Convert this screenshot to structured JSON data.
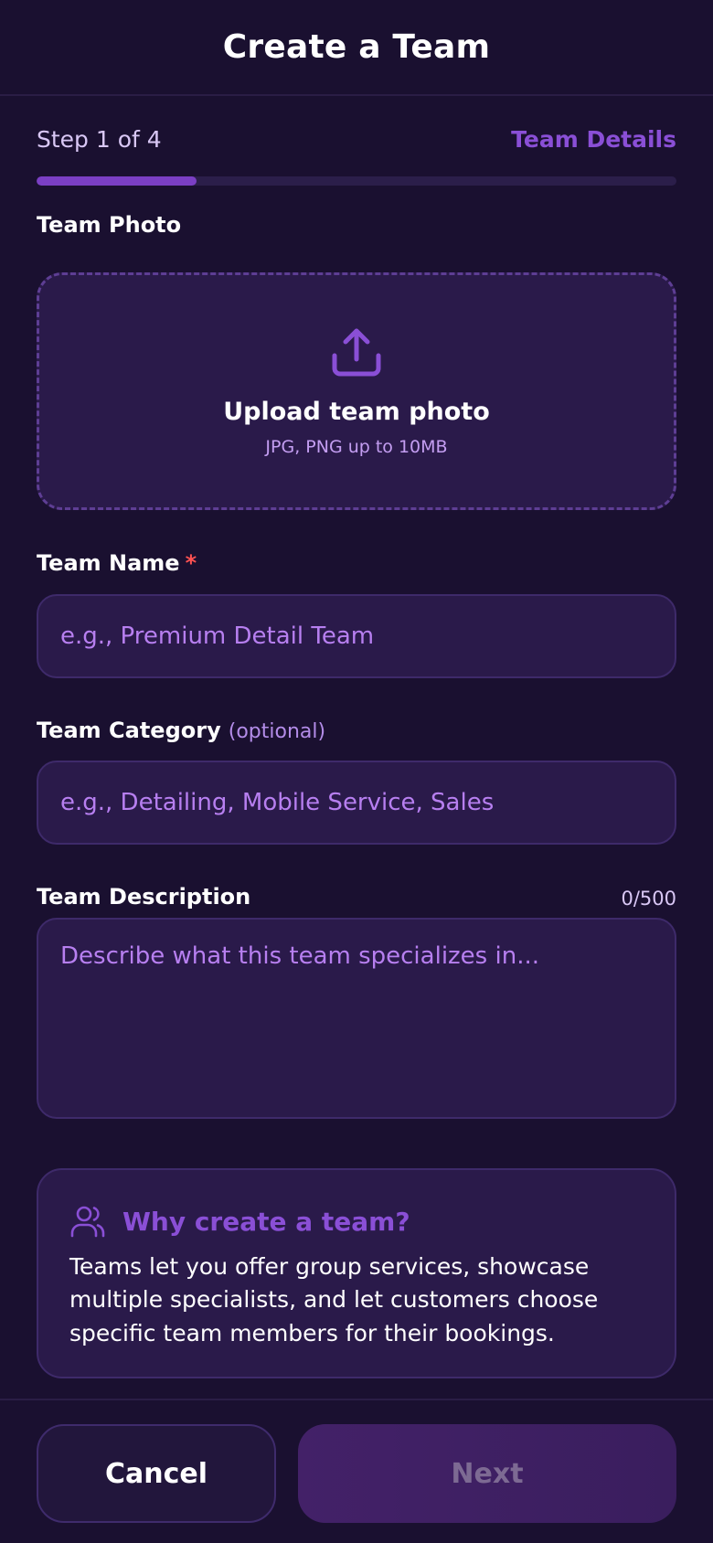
{
  "header": {
    "title": "Create a Team"
  },
  "progress": {
    "step_label": "Step 1 of 4",
    "step_title": "Team Details",
    "fraction": 0.25
  },
  "photo": {
    "label": "Team Photo",
    "upload_title": "Upload team photo",
    "upload_sub": "JPG, PNG up to 10MB",
    "icon": "upload-icon"
  },
  "team_name": {
    "label": "Team Name",
    "required_mark": "*",
    "value": "",
    "placeholder": "e.g., Premium Detail Team"
  },
  "team_category": {
    "label": "Team Category",
    "optional_note": "(optional)",
    "value": "",
    "placeholder": "e.g., Detailing, Mobile Service, Sales"
  },
  "team_description": {
    "label": "Team Description",
    "counter": "0/500",
    "value": "",
    "placeholder": "Describe what this team specializes in..."
  },
  "info": {
    "icon": "users-icon",
    "title": "Why create a team?",
    "body": "Teams let you offer group services, showcase multiple specialists, and let customers choose specific team members for their bookings."
  },
  "footer": {
    "cancel_label": "Cancel",
    "next_label": "Next"
  },
  "colors": {
    "background": "#1a1030",
    "accent": "#8a4fd6",
    "required": "#ff5252",
    "card": "#2a1a4a"
  }
}
